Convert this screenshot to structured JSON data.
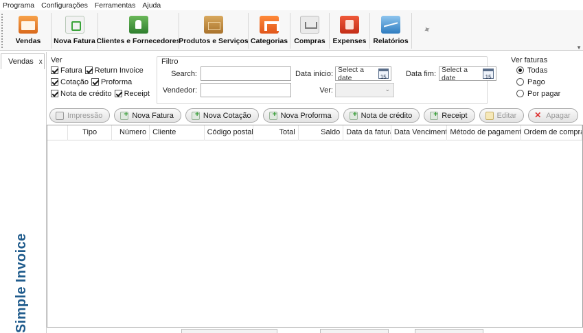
{
  "menu": [
    "Programa",
    "Configurações",
    "Ferramentas",
    "Ajuda"
  ],
  "toolbar": [
    {
      "label": "Vendas",
      "icon": "sales-icon"
    },
    {
      "label": "Nova Fatura",
      "icon": "new-invoice-icon"
    },
    {
      "label": "Clientes e Fornecedores",
      "icon": "contacts-icon"
    },
    {
      "label": "Produtos e Serviços",
      "icon": "products-icon"
    },
    {
      "label": "Categorias",
      "icon": "categories-icon"
    },
    {
      "label": "Compras",
      "icon": "purchases-icon"
    },
    {
      "label": "Expenses",
      "icon": "expenses-icon"
    },
    {
      "label": "Relatórios",
      "icon": "reports-icon"
    }
  ],
  "tabs": {
    "active": "Vendas",
    "close": "x"
  },
  "brand": "Simple Invoice",
  "ver": {
    "title": "Ver",
    "checks": [
      {
        "label": "Fatura",
        "checked": true
      },
      {
        "label": "Return Invoice",
        "checked": true
      },
      {
        "label": "Cotação",
        "checked": true
      },
      {
        "label": "Proforma",
        "checked": true
      },
      {
        "label": "Nota de crédito",
        "checked": true
      },
      {
        "label": "Receipt",
        "checked": true
      }
    ]
  },
  "filtro": {
    "title": "Filtro",
    "search_label": "Search:",
    "search_value": "",
    "vendedor_label": "Vendedor:",
    "vendedor_value": "",
    "data_inicio_label": "Data início:",
    "data_inicio_placeholder": "Select a date",
    "data_fim_label": "Data fim:",
    "data_fim_placeholder": "Select a date",
    "calendar_day": "15",
    "ver_label": "Ver:",
    "ver_value": ""
  },
  "ver_faturas": {
    "title": "Ver faturas",
    "options": [
      {
        "label": "Todas",
        "selected": true
      },
      {
        "label": "Pago",
        "selected": false
      },
      {
        "label": "Por pagar",
        "selected": false
      }
    ]
  },
  "actions": [
    {
      "label": "Impressão",
      "icon": "print-icon",
      "enabled": false
    },
    {
      "label": "Nova Fatura",
      "icon": "add-icon",
      "enabled": true
    },
    {
      "label": "Nova Cotação",
      "icon": "add-icon",
      "enabled": true
    },
    {
      "label": "Nova Proforma",
      "icon": "add-icon",
      "enabled": true
    },
    {
      "label": "Nota de crédito",
      "icon": "add-icon",
      "enabled": true
    },
    {
      "label": "Receipt",
      "icon": "add-icon",
      "enabled": true
    },
    {
      "label": "Editar",
      "icon": "edit-icon",
      "enabled": false
    },
    {
      "label": "Apagar",
      "icon": "delete-icon",
      "enabled": false
    }
  ],
  "grid": {
    "columns": [
      "",
      "Tipo",
      "Número",
      "Cliente",
      "Código postal",
      "Total",
      "Saldo",
      "Data da fatura",
      "Data Vencimento",
      "Método de pagamento",
      "Ordem de compra"
    ],
    "rows": []
  }
}
